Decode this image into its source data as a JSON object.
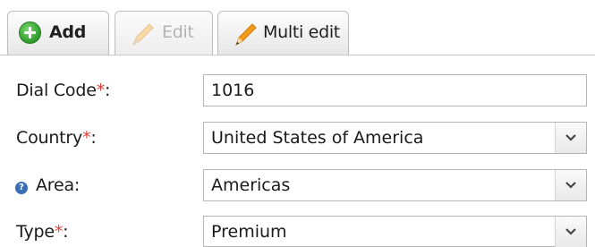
{
  "tabs": [
    {
      "label": "Add",
      "icon": "plus-icon"
    },
    {
      "label": "Edit",
      "icon": "pencil-icon"
    },
    {
      "label": "Multi edit",
      "icon": "pencil-icon"
    }
  ],
  "form": {
    "dial_code": {
      "label": "Dial Code",
      "required_mark": "*",
      "suffix": ":",
      "value": "1016"
    },
    "country": {
      "label": "Country",
      "required_mark": "*",
      "suffix": ":",
      "value": "United States of America"
    },
    "area": {
      "help_glyph": "?",
      "label": "Area:",
      "value": "Americas"
    },
    "type": {
      "label": "Type",
      "required_mark": "*",
      "suffix": ":",
      "value": "Premium"
    }
  },
  "colors": {
    "required": "#e23b3b",
    "help_icon": "#3a6fb8",
    "add_icon": "#2e9a2a"
  }
}
